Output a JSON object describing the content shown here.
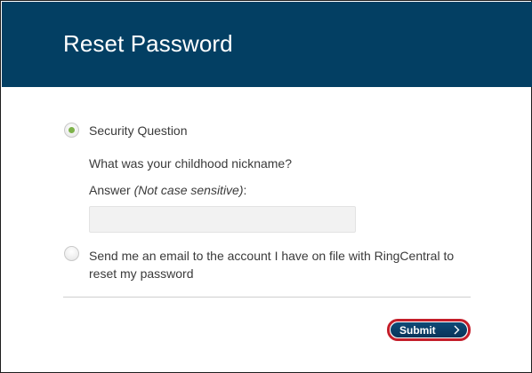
{
  "header": {
    "title": "Reset Password"
  },
  "options": {
    "security_question": {
      "label": "Security Question",
      "question": "What was your childhood nickname?",
      "answer_label": "Answer ",
      "answer_hint": "(Not case sensitive)",
      "answer_suffix": ":",
      "answer_value": "",
      "answer_placeholder": "",
      "selected": true
    },
    "email": {
      "label": "Send me an email to the account I have on file with RingCentral to reset my password",
      "selected": false
    }
  },
  "actions": {
    "submit_label": "Submit",
    "submit_icon": "chevron-right-icon"
  },
  "colors": {
    "header_bg": "#033f63",
    "radio_selected": "#7db24a",
    "button_bg": "#0a3c66",
    "highlight_ring": "#c41e2a"
  }
}
